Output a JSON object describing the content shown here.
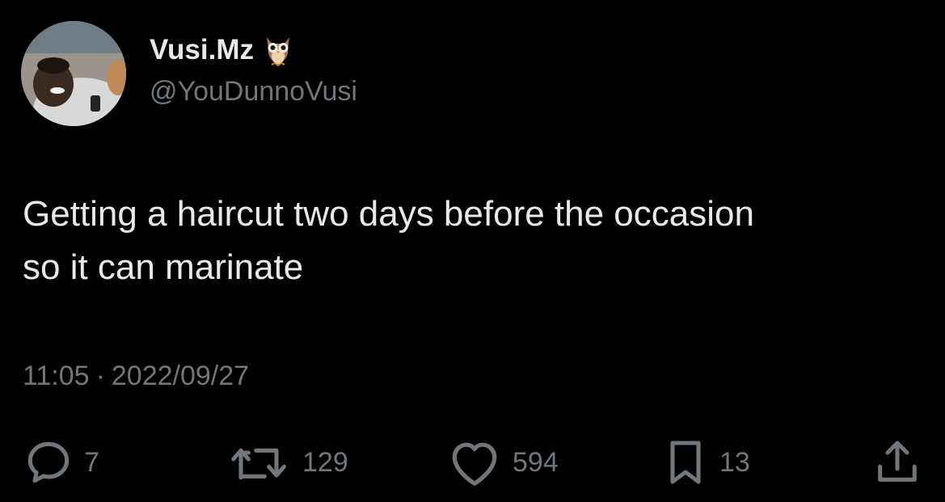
{
  "author": {
    "display_name": "Vusi.Mz",
    "handle": "@YouDunnoVusi",
    "name_emoji": "owl-emoji"
  },
  "tweet": {
    "lines": [
      "Getting a haircut two days before the occasion",
      "so it can marinate"
    ]
  },
  "meta": {
    "time": "11:05",
    "separator": "·",
    "date": "2022/09/27"
  },
  "actions": {
    "replies": {
      "icon": "reply-icon",
      "count": "7"
    },
    "retweets": {
      "icon": "retweet-icon",
      "count": "129"
    },
    "likes": {
      "icon": "heart-icon",
      "count": "594"
    },
    "bookmarks": {
      "icon": "bookmark-icon",
      "count": "13"
    },
    "share": {
      "icon": "share-icon"
    }
  },
  "colors": {
    "background": "#000000",
    "primary_text": "#e7e9ea",
    "secondary_text": "#71767b"
  }
}
